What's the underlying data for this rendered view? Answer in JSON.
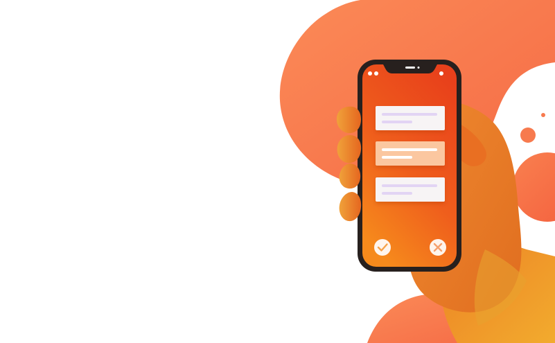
{
  "illustration": {
    "subject": "hand-holding-phone",
    "phone": {
      "cards": [
        {
          "state": "default"
        },
        {
          "state": "highlighted"
        },
        {
          "state": "default"
        }
      ],
      "actions": [
        {
          "icon": "check-icon"
        },
        {
          "icon": "close-icon"
        }
      ]
    }
  },
  "colors": {
    "blob_light": "#fb8a57",
    "blob_dark": "#f56a45",
    "screen_top": "#e8441c",
    "screen_bottom": "#f68a1c",
    "phone_frame": "#27201e",
    "hand_light": "#f2a53a",
    "hand_dark": "#e6761f",
    "card_bg": "#f7f4f5",
    "card_highlight_bg": "#fbc7a0",
    "card_line": "#dcc8f2"
  }
}
